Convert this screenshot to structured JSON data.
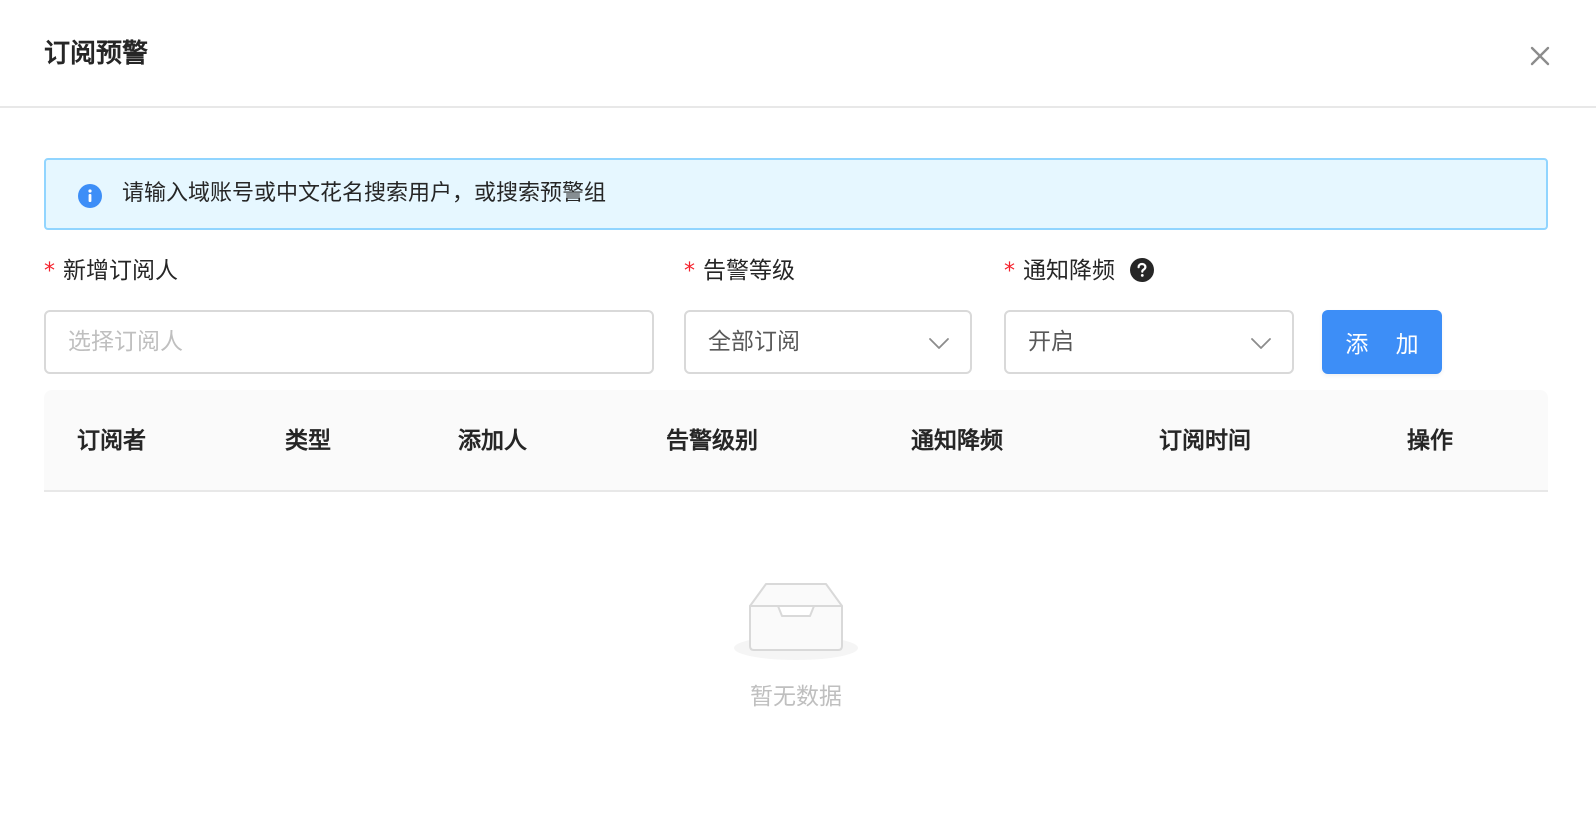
{
  "modal": {
    "title": "订阅预警",
    "close_icon": "close-icon"
  },
  "alert": {
    "icon": "info-circle-icon",
    "text": "请输入域账号或中文花名搜索用户，或搜索预警组",
    "background": "#e6f7ff",
    "border": "#91d5ff"
  },
  "form": {
    "required_mark": "*",
    "subscriber": {
      "label": "新增订阅人",
      "placeholder": "选择订阅人",
      "value": ""
    },
    "alert_level": {
      "label": "告警等级",
      "selected": "全部订阅"
    },
    "notify_throttle": {
      "label": "通知降频",
      "selected": "开启",
      "help_icon": "question-circle-icon"
    },
    "add_button": {
      "label": "添 加",
      "color": "#3d8ef7"
    }
  },
  "table": {
    "columns": [
      "订阅者",
      "类型",
      "添加人",
      "告警级别",
      "通知降频",
      "订阅时间",
      "操作"
    ],
    "rows": [],
    "empty_text": "暂无数据",
    "empty_icon": "empty-inbox-icon"
  }
}
